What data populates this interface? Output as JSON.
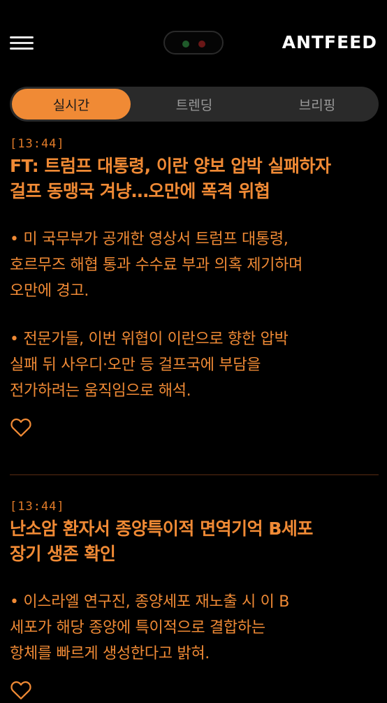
{
  "header": {
    "logo": "ANTFEED"
  },
  "tabs": [
    {
      "label": "실시간"
    },
    {
      "label": "트렌딩"
    },
    {
      "label": "브리핑"
    }
  ],
  "articles": [
    {
      "time": "[13:44]",
      "headline_line1": "FT: 트럼프 대통령, 이란 양보 압박 실패하자",
      "headline_line2": "걸프 동맹국 겨냥…오만에 폭격 위협",
      "bullet1_line1": "• 미 국무부가 공개한 영상서 트럼프 대통령,",
      "bullet1_line2": "호르무즈 해협 통과 수수료 부과 의혹 제기하며",
      "bullet1_line3": "오만에 경고.",
      "bullet2_line1": "• 전문가들, 이번 위협이 이란으로 향한 압박",
      "bullet2_line2": "실패 뒤 사우디·오만 등 걸프국에 부담을",
      "bullet2_line3": "전가하려는 움직임으로 해석."
    },
    {
      "time": "[13:44]",
      "headline_line1": "난소암 환자서 종양특이적 면역기억 B세포",
      "headline_line2": "장기 생존 확인",
      "bullet1_line1": "• 이스라엘 연구진, 종양세포 재노출 시 이 B",
      "bullet1_line2": "세포가 해당 종양에 특이적으로 결합하는",
      "bullet1_line3": "항체를 빠르게 생성한다고 밝혀."
    }
  ],
  "colors": {
    "accent": "#f08a35",
    "background": "#000000",
    "tab_bg": "#2a2a2a"
  },
  "icons": {
    "menu": "hamburger-menu-icon",
    "like": "heart-outline-icon"
  }
}
